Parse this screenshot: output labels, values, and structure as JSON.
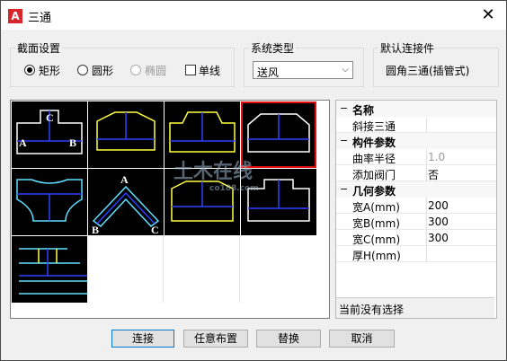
{
  "window": {
    "title": "三通"
  },
  "section_section": {
    "label": "截面设置",
    "options": [
      {
        "label": "矩形",
        "selected": true,
        "disabled": false
      },
      {
        "label": "圆形",
        "selected": false,
        "disabled": false
      },
      {
        "label": "椭圆",
        "selected": false,
        "disabled": true
      }
    ],
    "single_line_label": "单线",
    "single_line_checked": false
  },
  "system_type": {
    "label": "系统类型",
    "value": "送风"
  },
  "default_connector": {
    "label": "默认连接件",
    "value": "圆角三通(插管式)"
  },
  "thumbnails": {
    "count": 9,
    "selected_index": 3,
    "letters": {
      "a": "A",
      "b": "B",
      "c": "C"
    }
  },
  "properties": {
    "cat_name": "名称",
    "name_value": "斜接三通",
    "cat_params": "构件参数",
    "radius_label": "曲率半径",
    "radius_value": "1.0",
    "valve_label": "添加阀门",
    "valve_value": "否",
    "cat_geom": "几何参数",
    "width_a_label": "宽A(mm)",
    "width_a_value": "200",
    "width_b_label": "宽B(mm)",
    "width_b_value": "300",
    "width_c_label": "宽C(mm)",
    "width_c_value": "300",
    "thickness_label": "厚H(mm)",
    "thickness_value": "",
    "toggle": "−"
  },
  "status_text": "当前没有选择",
  "buttons": {
    "connect": "连接",
    "free_layout": "任意布置",
    "replace": "替换",
    "cancel": "取消"
  },
  "watermark": {
    "main": "土木在线",
    "sub": "co188.com"
  },
  "colors": {
    "selected_outline": "#e01010",
    "thumb_bg": "#000000",
    "accent": "#0078d7"
  }
}
